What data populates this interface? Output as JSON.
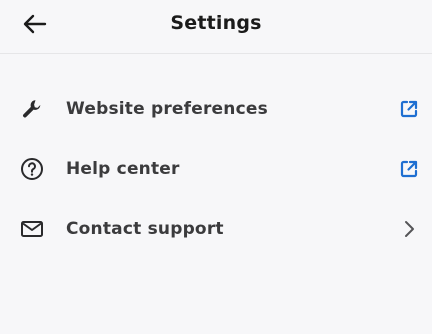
{
  "header": {
    "title": "Settings",
    "back_icon": "arrow-left-icon"
  },
  "menu": {
    "items": [
      {
        "label": "Website preferences",
        "icon": "wrench-icon",
        "trailing_icon": "external-link-icon"
      },
      {
        "label": "Help center",
        "icon": "question-circle-icon",
        "trailing_icon": "external-link-icon"
      },
      {
        "label": "Contact support",
        "icon": "envelope-icon",
        "trailing_icon": "chevron-right-icon"
      }
    ]
  },
  "colors": {
    "background": "#f7f7f9",
    "accent": "#1f6fd1",
    "text": "#3b3b3d",
    "divider": "#e6e6e8"
  }
}
